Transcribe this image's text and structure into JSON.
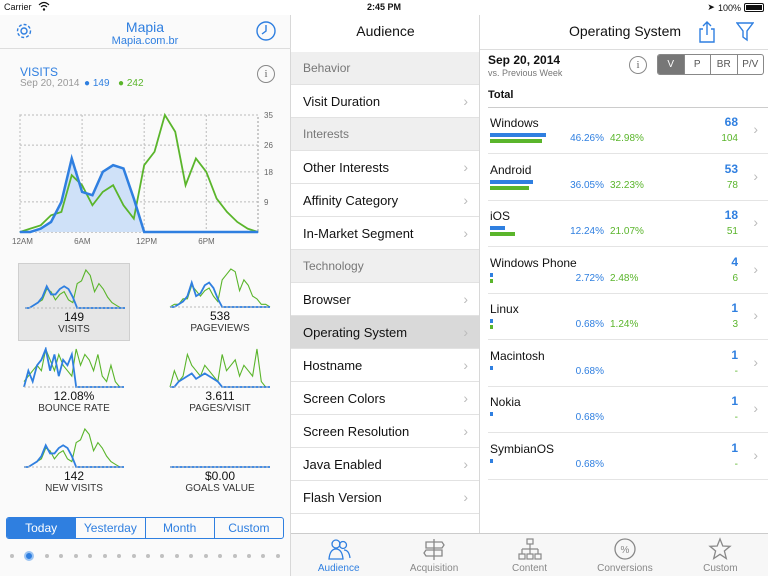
{
  "status": {
    "carrier": "Carrier",
    "time": "2:45 PM",
    "battery": "100%"
  },
  "left": {
    "app_title": "Mapia",
    "app_subtitle": "Mapia.com.br",
    "visits_title": "VISITS",
    "date": "Sep 20, 2014",
    "legend_blue": "149",
    "legend_green": "242",
    "info": "i",
    "tiles": [
      {
        "value": "149",
        "label": "VISITS"
      },
      {
        "value": "538",
        "label": "PAGEVIEWS"
      },
      {
        "value": "12.08%",
        "label": "BOUNCE RATE"
      },
      {
        "value": "3.611",
        "label": "PAGES/VISIT"
      },
      {
        "value": "142",
        "label": "NEW VISITS"
      },
      {
        "value": "$0.00",
        "label": "GOALS VALUE"
      }
    ],
    "segments": [
      "Today",
      "Yesterday",
      "Month",
      "Custom"
    ]
  },
  "chart_data": {
    "type": "area",
    "title": "VISITS",
    "x_ticks": [
      "12AM",
      "6AM",
      "12PM",
      "6PM"
    ],
    "y_ticks": [
      35,
      26,
      18,
      9
    ],
    "ylim": [
      0,
      35
    ],
    "x": [
      0,
      1,
      2,
      3,
      4,
      5,
      6,
      7,
      8,
      9,
      10,
      11,
      12,
      13,
      14,
      15,
      16,
      17,
      18,
      19,
      20,
      21,
      22,
      23
    ],
    "series": [
      {
        "name": "149",
        "color": "#2f7fe0",
        "values": [
          0,
          0,
          1,
          3,
          9,
          22,
          12,
          11,
          18,
          20,
          19,
          10,
          0,
          0,
          0,
          0,
          0,
          0,
          0,
          0,
          0,
          0,
          0,
          0
        ]
      },
      {
        "name": "242",
        "color": "#5ab52b",
        "values": [
          0,
          1,
          2,
          5,
          6,
          17,
          14,
          8,
          12,
          14,
          8,
          4,
          20,
          24,
          35,
          30,
          14,
          22,
          18,
          10,
          6,
          3,
          1,
          0
        ]
      }
    ]
  },
  "middle": {
    "title": "Audience",
    "items": [
      {
        "label": "Behavior",
        "type": "header"
      },
      {
        "label": "Visit Duration",
        "type": "item"
      },
      {
        "label": "Interests",
        "type": "header"
      },
      {
        "label": "Other Interests",
        "type": "item"
      },
      {
        "label": "Affinity Category",
        "type": "item"
      },
      {
        "label": "In-Market Segment",
        "type": "item"
      },
      {
        "label": "Technology",
        "type": "header"
      },
      {
        "label": "Browser",
        "type": "item"
      },
      {
        "label": "Operating System",
        "type": "selected"
      },
      {
        "label": "Hostname",
        "type": "item"
      },
      {
        "label": "Screen Colors",
        "type": "item"
      },
      {
        "label": "Screen Resolution",
        "type": "item"
      },
      {
        "label": "Java Enabled",
        "type": "item"
      },
      {
        "label": "Flash Version",
        "type": "item"
      }
    ]
  },
  "right": {
    "title": "Operating System",
    "date": "Sep 20, 2014",
    "vs": "vs. Previous Week",
    "info": "i",
    "segments": [
      "V",
      "P",
      "BR",
      "P/V"
    ],
    "total_label": "Total",
    "rows": [
      {
        "name": "Windows",
        "pct_blue": "46.26%",
        "pct_green": "42.98%",
        "num_blue": "68",
        "num_green": "104",
        "blue_frac": 0.4626,
        "green_frac": 0.4298
      },
      {
        "name": "Android",
        "pct_blue": "36.05%",
        "pct_green": "32.23%",
        "num_blue": "53",
        "num_green": "78",
        "blue_frac": 0.3605,
        "green_frac": 0.3223
      },
      {
        "name": "iOS",
        "pct_blue": "12.24%",
        "pct_green": "21.07%",
        "num_blue": "18",
        "num_green": "51",
        "blue_frac": 0.1224,
        "green_frac": 0.2107
      },
      {
        "name": "Windows Phone",
        "pct_blue": "2.72%",
        "pct_green": "2.48%",
        "num_blue": "4",
        "num_green": "6",
        "blue_frac": 0.0272,
        "green_frac": 0.0248
      },
      {
        "name": "Linux",
        "pct_blue": "0.68%",
        "pct_green": "1.24%",
        "num_blue": "1",
        "num_green": "3",
        "blue_frac": 0.0068,
        "green_frac": 0.0124
      },
      {
        "name": "Macintosh",
        "pct_blue": "0.68%",
        "pct_green": "",
        "num_blue": "1",
        "num_green": "-",
        "blue_frac": 0.0068,
        "green_frac": 0
      },
      {
        "name": "Nokia",
        "pct_blue": "0.68%",
        "pct_green": "",
        "num_blue": "1",
        "num_green": "-",
        "blue_frac": 0.0068,
        "green_frac": 0
      },
      {
        "name": "SymbianOS",
        "pct_blue": "0.68%",
        "pct_green": "",
        "num_blue": "1",
        "num_green": "-",
        "blue_frac": 0.0068,
        "green_frac": 0
      }
    ]
  },
  "tabs": [
    {
      "label": "Audience",
      "icon": "audience-icon",
      "active": true
    },
    {
      "label": "Acquisition",
      "icon": "acquisition-icon",
      "active": false
    },
    {
      "label": "Content",
      "icon": "content-icon",
      "active": false
    },
    {
      "label": "Conversions",
      "icon": "conversions-icon",
      "active": false
    },
    {
      "label": "Custom",
      "icon": "star-icon",
      "active": false
    }
  ],
  "colors": {
    "accent": "#2f7fe0",
    "green": "#5ab52b"
  }
}
